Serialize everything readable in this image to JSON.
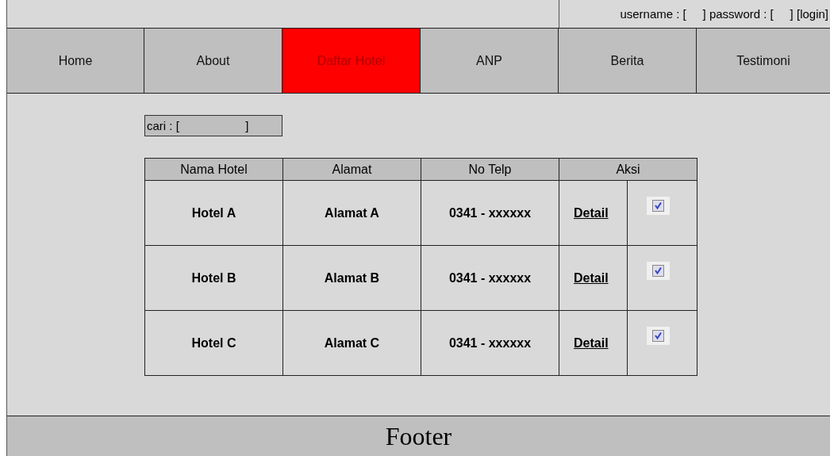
{
  "login_bar": {
    "text": "username : [     ] password : [     ] [login]"
  },
  "nav": [
    {
      "label": "Home",
      "selected": false
    },
    {
      "label": "About",
      "selected": false
    },
    {
      "label": "Daftar Hotel",
      "selected": true
    },
    {
      "label": "ANP",
      "selected": false
    },
    {
      "label": "Berita",
      "selected": false
    },
    {
      "label": "Testimoni",
      "selected": false
    }
  ],
  "search": {
    "text": "cari : [                    ]"
  },
  "table": {
    "columns": [
      "Nama Hotel",
      "Alamat",
      "No Telp",
      "Aksi"
    ],
    "rows": [
      {
        "name": "Hotel A",
        "address": "Alamat A",
        "phone": "0341 - xxxxxx",
        "action": "Detail",
        "checked": true
      },
      {
        "name": "Hotel B",
        "address": "Alamat B",
        "phone": "0341 - xxxxxx",
        "action": "Detail",
        "checked": true
      },
      {
        "name": "Hotel C",
        "address": "Alamat C",
        "phone": "0341 - xxxxxx",
        "action": "Detail",
        "checked": true
      }
    ]
  },
  "footer": {
    "text": "Footer"
  }
}
